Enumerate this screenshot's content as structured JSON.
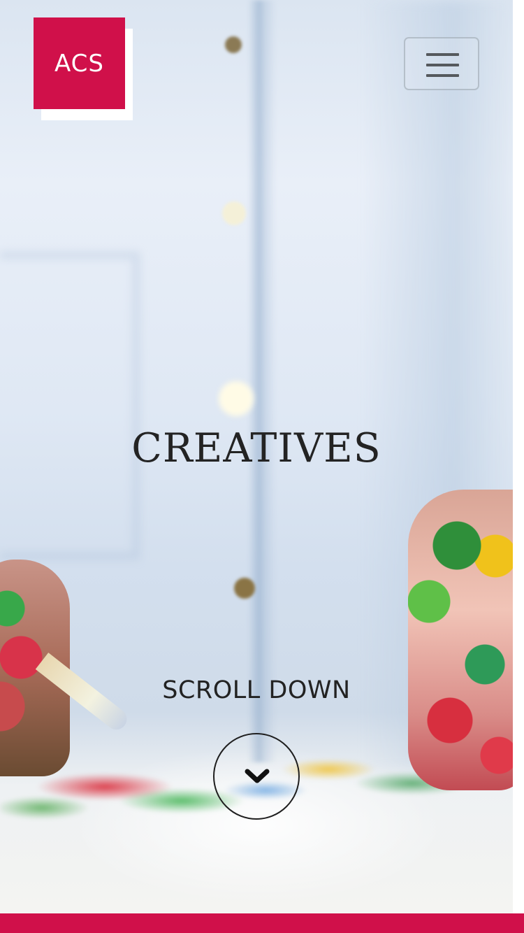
{
  "brand": {
    "logo_text": "ACS",
    "accent_color": "#d0104a"
  },
  "header": {
    "menu_icon": "hamburger-menu-icon"
  },
  "hero": {
    "title": "CREATIVES",
    "scroll_label": "SCROLL DOWN",
    "scroll_icon": "chevron-down-icon"
  }
}
